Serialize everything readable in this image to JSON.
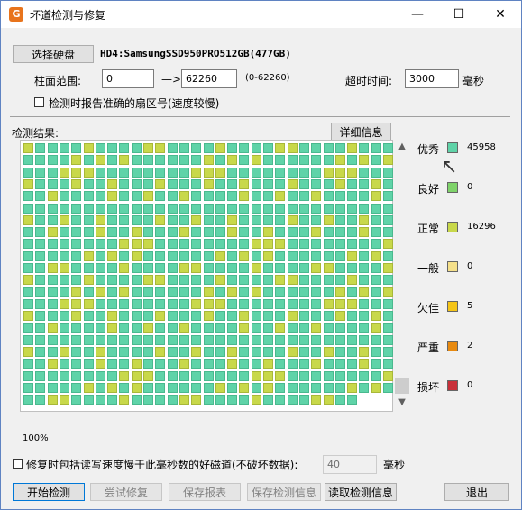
{
  "window": {
    "title": "坏道检测与修复",
    "minimize": "—",
    "maximize": "☐",
    "close": "✕"
  },
  "disk": {
    "select_button": "选择硬盘",
    "name": "HD4:SamsungSSD950PRO512GB(477GB)"
  },
  "range": {
    "label": "柱面范围:",
    "start": "0",
    "arrow": "—>",
    "end": "62260",
    "hint": "(0-62260)"
  },
  "timeout": {
    "label": "超时时间:",
    "value": "3000",
    "unit": "毫秒"
  },
  "report_sector": {
    "label": "检测时报告准确的扇区号(速度较慢)",
    "checked": false
  },
  "results": {
    "label": "检测结果:",
    "detail_button": "详细信息",
    "progress": "100%"
  },
  "legend": [
    {
      "label": "优秀",
      "count": "45958",
      "color": "#5fd3a8"
    },
    {
      "label": "良好",
      "count": "0",
      "color": "#7fd36a"
    },
    {
      "label": "正常",
      "count": "16296",
      "color": "#c8d84a"
    },
    {
      "label": "一般",
      "count": "0",
      "color": "#f5e08a"
    },
    {
      "label": "欠佳",
      "count": "5",
      "color": "#f5c518"
    },
    {
      "label": "严重",
      "count": "2",
      "color": "#e88a10"
    },
    {
      "label": "损坏",
      "count": "0",
      "color": "#c8303a"
    }
  ],
  "repair": {
    "label": "修复时包括读写速度慢于此毫秒数的好磁道(不破坏数据):",
    "value": "40",
    "unit": "毫秒",
    "checked": false
  },
  "buttons": {
    "start": "开始检测",
    "try_repair": "尝试修复",
    "save_report": "保存报表",
    "save_info": "保存检测信息",
    "read_info": "读取检测信息",
    "exit": "退出"
  },
  "scroll": {
    "up": "▲",
    "down": "▼"
  },
  "grid": {
    "cols": 31,
    "rows": 22,
    "last_row_cells": 28,
    "cursor": "↖"
  }
}
